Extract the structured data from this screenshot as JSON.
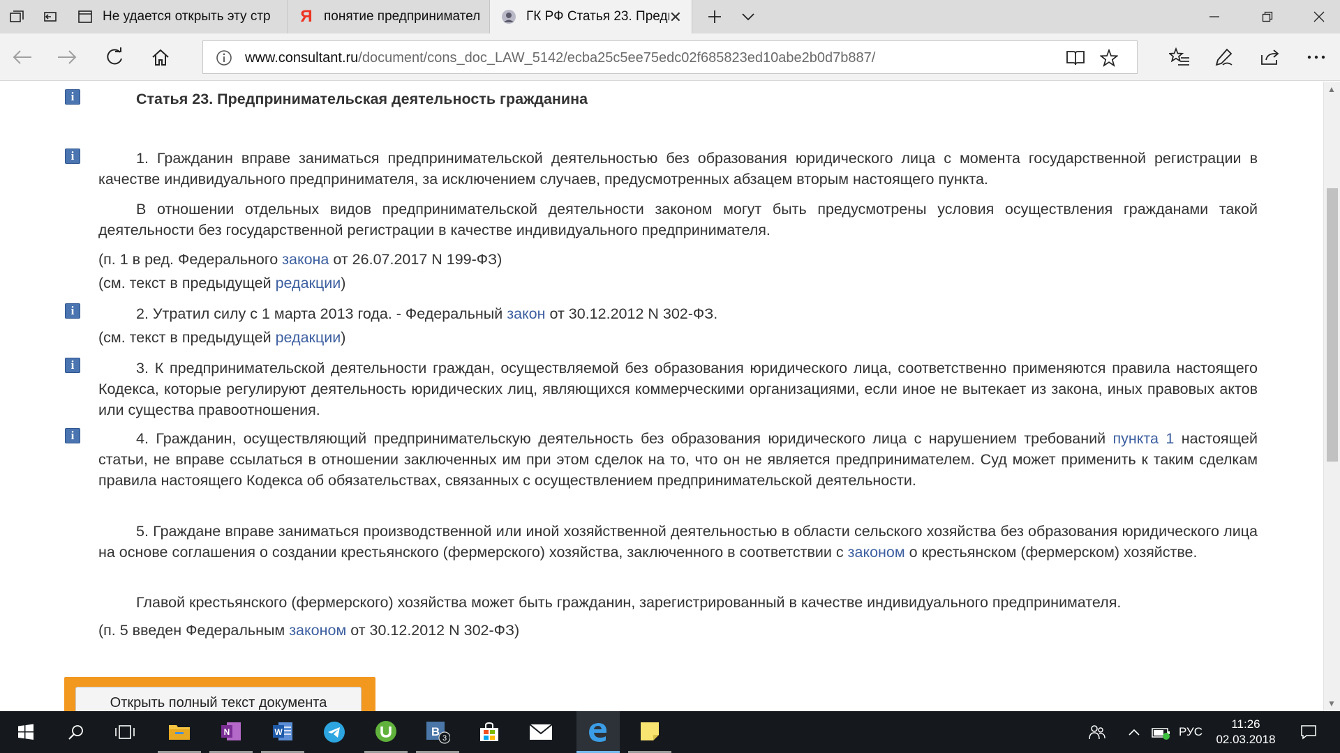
{
  "tabs": [
    {
      "title": "Не удается открыть эту стр",
      "icon": "page-icon"
    },
    {
      "title": "понятие предпринимател",
      "icon": "yandex-icon"
    },
    {
      "title": "ГК РФ Статья 23. Предп",
      "icon": "consultant-icon",
      "active": true
    }
  ],
  "address": {
    "host": "www.consultant.ru",
    "path": "/document/cons_doc_LAW_5142/ecba25c5ee75edc02f685823ed10abe2b0d7b887/"
  },
  "article": {
    "heading": "Статья 23. Предпринимательская деятельность гражданина",
    "p1": "1. Гражданин вправе заниматься предпринимательской деятельностью без образования юридического лица с момента государственной регистрации в качестве индивидуального предпринимателя, за исключением случаев, предусмотренных абзацем вторым настоящего пункта.",
    "p1b": "В отношении отдельных видов предпринимательской деятельности законом могут быть предусмотрены условия осуществления гражданами такой деятельности без государственной регистрации в качестве индивидуального предпринимателя.",
    "note1_pre": "(п. 1 в ред. Федерального ",
    "note1_link": "закона",
    "note1_post": " от 26.07.2017 N 199-ФЗ)",
    "see1_pre": "(см. текст в предыдущей ",
    "see1_link": "редакции",
    "see1_post": ")",
    "p2_pre": "2. Утратил силу с 1 марта 2013 года. - Федеральный ",
    "p2_link": "закон",
    "p2_post": " от 30.12.2012 N 302-ФЗ.",
    "see2_pre": "(см. текст в предыдущей ",
    "see2_link": "редакции",
    "see2_post": ")",
    "p3": "3. К предпринимательской деятельности граждан, осуществляемой без образования юридического лица, соответственно применяются правила настоящего Кодекса, которые регулируют деятельность юридических лиц, являющихся коммерческими организациями, если иное не вытекает из закона, иных правовых актов или существа правоотношения.",
    "p4_pre": "4. Гражданин, осуществляющий предпринимательскую деятельность без образования юридического лица с нарушением требований ",
    "p4_link": "пункта 1",
    "p4_post": " настоящей статьи, не вправе ссылаться в отношении заключенных им при этом сделок на то, что он не является предпринимателем. Суд может применить к таким сделкам правила настоящего Кодекса об обязательствах, связанных с осуществлением предпринимательской деятельности.",
    "p5_pre": "5. Граждане вправе заниматься производственной или иной хозяйственной деятельностью в области сельского хозяйства без образования юридического лица на основе соглашения о создании крестьянского (фермерского) хозяйства, заключенного в соответствии с ",
    "p5_link": "законом",
    "p5_post": " о крестьянском (фермерском) хозяйстве.",
    "p5b": "Главой крестьянского (фермерского) хозяйства может быть гражданин, зарегистрированный в качестве индивидуального предпринимателя.",
    "note5_pre": "(п. 5 введен Федеральным ",
    "note5_link": "законом",
    "note5_post": " от 30.12.2012 N 302-ФЗ)",
    "info_icon_glyph": "i"
  },
  "open_full_text_button": "Открыть полный текст документа",
  "scroll_position": 0.28,
  "taskbar": {
    "apps": [
      "file-explorer",
      "onenote",
      "word",
      "telegram",
      "utorrent",
      "vk",
      "store",
      "mail",
      "edge",
      "sticky-notes"
    ],
    "vk_badge": "3",
    "vk_letter": "B",
    "language": "РУС",
    "time": "11:26",
    "date": "02.03.2018"
  },
  "colors": {
    "link": "#3d5fa0",
    "info_icon": "#4a75b0",
    "button_frame": "#f3981f",
    "taskbar": "#15191d",
    "edge_accent": "#76b9ed"
  }
}
